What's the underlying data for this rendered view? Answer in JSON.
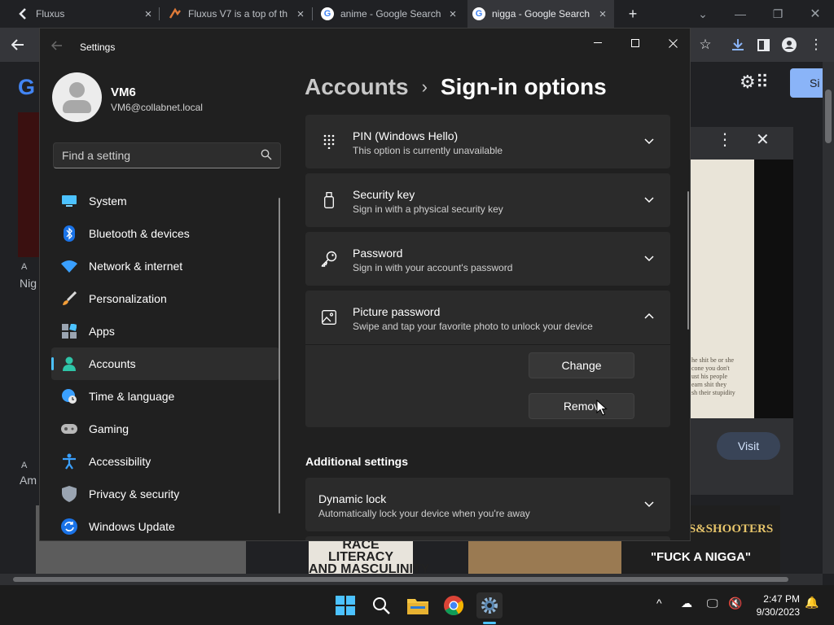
{
  "browser": {
    "tabs": [
      {
        "title": "Fluxus",
        "favicon": "back-chevron-icon"
      },
      {
        "title": "Fluxus V7 is a top of th",
        "favicon": "fluxus-logo-icon"
      },
      {
        "title": "anime - Google Search",
        "favicon": "google-icon"
      },
      {
        "title": "nigga - Google Search",
        "favicon": "google-icon"
      }
    ],
    "google_letter": "G",
    "google_partial_logo": "G",
    "signin_partial": "Si",
    "visit_label": "Visit",
    "left_result_1": "Nig",
    "left_result_2": "Am",
    "left_source_glyph": "A",
    "thumb_race_text": "RACE\nLITERACY\nAND MASCULINITY",
    "thumb_shooters_text": "S&SHOOTERS",
    "thumb_fuck_text": "\"FUCK A NIGGA\"",
    "preview_text": "he shit be or she\ncone you don't\nust his people\nearn shit they\nsh their stupidity"
  },
  "settings": {
    "app_title": "Settings",
    "profile": {
      "name": "VM6",
      "email": "VM6@collabnet.local"
    },
    "search": {
      "placeholder": "Find a setting"
    },
    "nav": [
      {
        "label": "System",
        "icon": "monitor-icon",
        "selected": false
      },
      {
        "label": "Bluetooth & devices",
        "icon": "bluetooth-icon",
        "selected": false
      },
      {
        "label": "Network & internet",
        "icon": "wifi-icon",
        "selected": false
      },
      {
        "label": "Personalization",
        "icon": "brush-icon",
        "selected": false
      },
      {
        "label": "Apps",
        "icon": "apps-icon",
        "selected": false
      },
      {
        "label": "Accounts",
        "icon": "person-icon",
        "selected": true
      },
      {
        "label": "Time & language",
        "icon": "globe-clock-icon",
        "selected": false
      },
      {
        "label": "Gaming",
        "icon": "gamepad-icon",
        "selected": false
      },
      {
        "label": "Accessibility",
        "icon": "accessibility-icon",
        "selected": false
      },
      {
        "label": "Privacy & security",
        "icon": "shield-icon",
        "selected": false
      },
      {
        "label": "Windows Update",
        "icon": "update-icon",
        "selected": false
      }
    ],
    "breadcrumb": {
      "parent": "Accounts",
      "separator": "›",
      "current": "Sign-in options"
    },
    "options": [
      {
        "title": "PIN (Windows Hello)",
        "subtitle": "This option is currently unavailable",
        "icon": "keypad-icon",
        "expanded": false
      },
      {
        "title": "Security key",
        "subtitle": "Sign in with a physical security key",
        "icon": "usb-key-icon",
        "expanded": false
      },
      {
        "title": "Password",
        "subtitle": "Sign in with your account's password",
        "icon": "key-icon",
        "expanded": false
      },
      {
        "title": "Picture password",
        "subtitle": "Swipe and tap your favorite photo to unlock your device",
        "icon": "picture-icon",
        "expanded": true
      }
    ],
    "picture_buttons": {
      "change": "Change",
      "remove": "Remov"
    },
    "additional_settings": {
      "title": "Additional settings",
      "items": [
        {
          "title": "Dynamic lock",
          "subtitle": "Automatically lock your device when you're away"
        }
      ]
    }
  },
  "taskbar": {
    "time": "2:47 PM",
    "date": "9/30/2023",
    "apps": [
      "start-icon",
      "search-icon",
      "file-explorer-icon",
      "chrome-icon",
      "settings-icon"
    ]
  },
  "colors": {
    "accent": "#4cc2ff",
    "window_bg": "#202020",
    "card_bg": "#2b2b2b",
    "browser_bg": "#202124"
  }
}
